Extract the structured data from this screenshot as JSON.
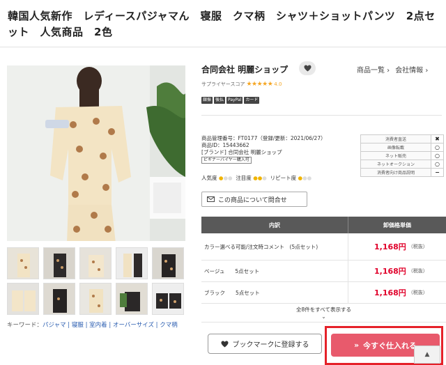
{
  "product": {
    "title": "韓国人気新作　レディースパジャマん　寝服　クマ柄　シャツ＋ショットパンツ　2点セット　人気商品　2色"
  },
  "keywords": {
    "label": "キーワード：",
    "items": [
      "パジャマ",
      "寝服",
      "室内着",
      "オーバーサイズ",
      "クマ柄"
    ],
    "separator": " | "
  },
  "shop": {
    "name": "合同会社 明麗ショップ",
    "links": [
      "商品一覧 ›",
      "会社情報 ›"
    ],
    "rating_label": "サプライヤースコア",
    "rating_stars": "★★★★★",
    "rating_value": "4.0",
    "badges": [
      "銀振",
      "後払",
      "PayPal",
      "カード"
    ]
  },
  "info": {
    "lines": [
      "商品管理番号：FT0177（登録/更新：2021/06/27）",
      "商品ID：15443662",
      "[ブランド] 合同会社 明麗ショップ"
    ],
    "beginner_tag": "ビギナーバイヤー購入可",
    "popularity_label": "人気度",
    "attention_label": "注目度",
    "repeat_label": "リピート度",
    "icon_on": "●",
    "icon_off": "●"
  },
  "features": [
    {
      "label": "消費者直送",
      "value": "✖"
    },
    {
      "label": "画像転載",
      "value": "○"
    },
    {
      "label": "ネット販売",
      "value": "○"
    },
    {
      "label": "ネットオークション",
      "value": "○"
    },
    {
      "label": "消費者向け商品説明",
      "value": "−"
    }
  ],
  "inquiry": {
    "label": "この商品について問合せ",
    "icon": "mail-icon"
  },
  "price_table": {
    "headers": [
      "内訳",
      "卸価格単価"
    ],
    "rows": [
      {
        "desc": "カラー選べる可能/注文時コメント　(5点セット)",
        "price": "1,168円",
        "tax": "（税抜）"
      },
      {
        "desc": "ベージュ　　5点セット",
        "price": "1,168円",
        "tax": "（税抜）"
      },
      {
        "desc": "ブラック　　5点セット",
        "price": "1,168円",
        "tax": "（税抜）"
      }
    ],
    "show_all": "全8件をすべて表示する",
    "show_all_chevron": "⌄"
  },
  "actions": {
    "bookmark": "ブックマークに登録する",
    "buy": "今すぐ仕入れる",
    "buy_icon": "»",
    "to_top": "▲"
  },
  "colors": {
    "price": "#e0002a",
    "buy": "#e85a6c",
    "highlight": "#e52129",
    "header": "#595959"
  }
}
